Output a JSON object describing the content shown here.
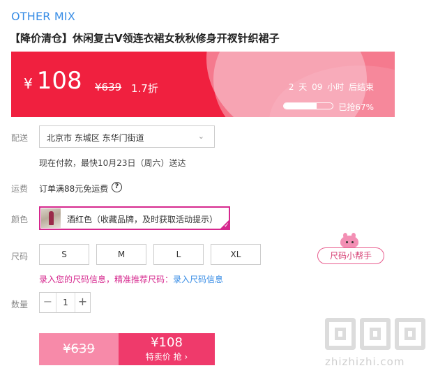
{
  "product": {
    "brand": "OTHER MIX",
    "title": "【降价清仓】休闲复古V领连衣裙女秋秋修身开衩针织裙子"
  },
  "promo": {
    "currency": "¥",
    "price": "108",
    "original_price": "¥639",
    "discount": "1.7折",
    "countdown": "2 天 09 小时 后结束",
    "sold_fraction": 0.67,
    "sold_label": "已抢67%",
    "colors": {
      "banner": "#f0203f"
    }
  },
  "delivery": {
    "label": "配送",
    "address": "北京市 东城区 东华门街道",
    "note": "现在付款，最快10月23日（周六）送达"
  },
  "shipping": {
    "label": "运费",
    "text": "订单满88元免运费",
    "help_icon": "?"
  },
  "color": {
    "label": "颜色",
    "selected": "酒红色（收藏品牌，及时获取活动提示）",
    "check_icon": "✓"
  },
  "size": {
    "label": "尺码",
    "options": [
      "S",
      "M",
      "L",
      "XL"
    ],
    "helper": "尺码小帮手",
    "tip_a": "录入您的尺码信息，",
    "tip_b": "精准推荐尺码：",
    "tip_c": "录入尺码信息"
  },
  "quantity": {
    "label": "数量",
    "value": "1",
    "minus": "−",
    "plus": "+"
  },
  "buy": {
    "original_price": "¥639",
    "price": "¥108",
    "cta": "特卖价 抢 ›",
    "colors": {
      "button": "#ef3a6b",
      "orig": "#f78aa9"
    }
  },
  "watermark": {
    "text": "zhizhizhi.com"
  }
}
